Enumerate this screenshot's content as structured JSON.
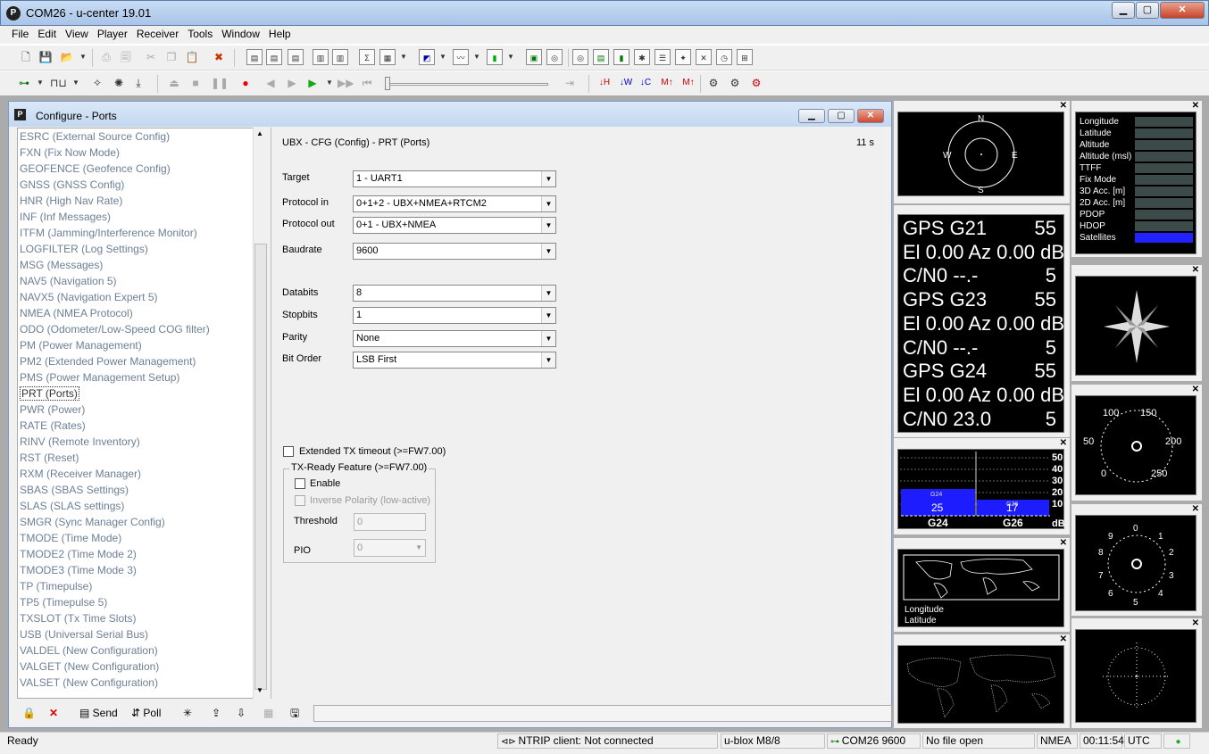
{
  "window": {
    "title": "COM26 - u-center 19.01",
    "app_icon": "P"
  },
  "menu": [
    "File",
    "Edit",
    "View",
    "Player",
    "Receiver",
    "Tools",
    "Window",
    "Help"
  ],
  "config": {
    "title": "Configure - Ports",
    "header": "UBX - CFG (Config) - PRT (Ports)",
    "age": "11 s",
    "messages": [
      "ESRC (External Source Config)",
      "FXN (Fix Now Mode)",
      "GEOFENCE (Geofence Config)",
      "GNSS (GNSS Config)",
      "HNR (High Nav Rate)",
      "INF (Inf Messages)",
      "ITFM (Jamming/Interference Monitor)",
      "LOGFILTER (Log Settings)",
      "MSG (Messages)",
      "NAV5 (Navigation 5)",
      "NAVX5 (Navigation Expert 5)",
      "NMEA (NMEA Protocol)",
      "ODO (Odometer/Low-Speed COG filter)",
      "PM (Power Management)",
      "PM2 (Extended Power Management)",
      "PMS (Power Management Setup)",
      "PRT (Ports)",
      "PWR (Power)",
      "RATE (Rates)",
      "RINV (Remote Inventory)",
      "RST (Reset)",
      "RXM (Receiver Manager)",
      "SBAS (SBAS Settings)",
      "SLAS (SLAS settings)",
      "SMGR (Sync Manager Config)",
      "TMODE (Time Mode)",
      "TMODE2 (Time Mode 2)",
      "TMODE3 (Time Mode 3)",
      "TP (Timepulse)",
      "TP5 (Timepulse 5)",
      "TXSLOT (Tx Time Slots)",
      "USB (Universal Serial Bus)",
      "VALDEL (New Configuration)",
      "VALGET (New Configuration)",
      "VALSET (New Configuration)"
    ],
    "selected": "PRT (Ports)",
    "fields": {
      "target": {
        "label": "Target",
        "value": "1 - UART1"
      },
      "protocol_in": {
        "label": "Protocol in",
        "value": "0+1+2 - UBX+NMEA+RTCM2"
      },
      "protocol_out": {
        "label": "Protocol out",
        "value": "0+1 - UBX+NMEA"
      },
      "baudrate": {
        "label": "Baudrate",
        "value": "9600"
      },
      "databits": {
        "label": "Databits",
        "value": "8"
      },
      "stopbits": {
        "label": "Stopbits",
        "value": "1"
      },
      "parity": {
        "label": "Parity",
        "value": "None"
      },
      "bitorder": {
        "label": "Bit Order",
        "value": "LSB First"
      }
    },
    "ext_tx": "Extended TX timeout (>=FW7.00)",
    "txready": {
      "legend": "TX-Ready Feature (>=FW7.00)",
      "enable": "Enable",
      "inverse": "Inverse Polarity (low-active)",
      "threshold_label": "Threshold",
      "threshold": "0",
      "pio_label": "PIO",
      "pio": "0"
    },
    "send": "Send",
    "poll": "Poll"
  },
  "status": {
    "ready": "Ready",
    "ntrip": "NTRIP client: Not connected",
    "receiver": "u-blox M8/8",
    "port": "COM26 9600",
    "file": "No file open",
    "protocol": "NMEA",
    "time": "00:11:54",
    "tz": "UTC"
  },
  "navinfo": [
    "Longitude",
    "Latitude",
    "Altitude",
    "Altitude (msl)",
    "TTFF",
    "Fix Mode",
    "3D Acc. [m]",
    "2D Acc. [m]",
    "PDOP",
    "HDOP",
    "Satellites"
  ],
  "sky": {
    "labels": [
      "N",
      "E",
      "S",
      "W"
    ]
  },
  "sats": [
    [
      "GPS G21",
      "55",
      "El 0.00 Az 0.00 dB",
      "C/N0 --.-",
      "5"
    ],
    [
      "GPS G23",
      "55",
      "El 0.00 Az 0.00 dB",
      "C/N0 --.-",
      "5"
    ],
    [
      "GPS G24",
      "55",
      "El 0.00 Az 0.00 dB",
      "C/N0 23.0",
      "5"
    ]
  ],
  "cn0": {
    "scale": [
      "50",
      "40",
      "30",
      "20",
      "10",
      "dB"
    ],
    "bars": [
      {
        "sat": "G24",
        "value": "25",
        "tag": "G24"
      },
      {
        "sat": "G26",
        "value": "17",
        "tag": "G26"
      }
    ]
  },
  "map": {
    "lon": "Longitude",
    "lat": "Latitude"
  },
  "gauge1": [
    "100",
    "150",
    "50",
    "200",
    "0",
    "250"
  ],
  "gauge2": [
    "0",
    "1",
    "2",
    "3",
    "4",
    "5",
    "6",
    "7",
    "8",
    "9"
  ],
  "colors": {
    "accent": "#2222ff",
    "panel": "#000000",
    "muted": "#6d7f96"
  }
}
